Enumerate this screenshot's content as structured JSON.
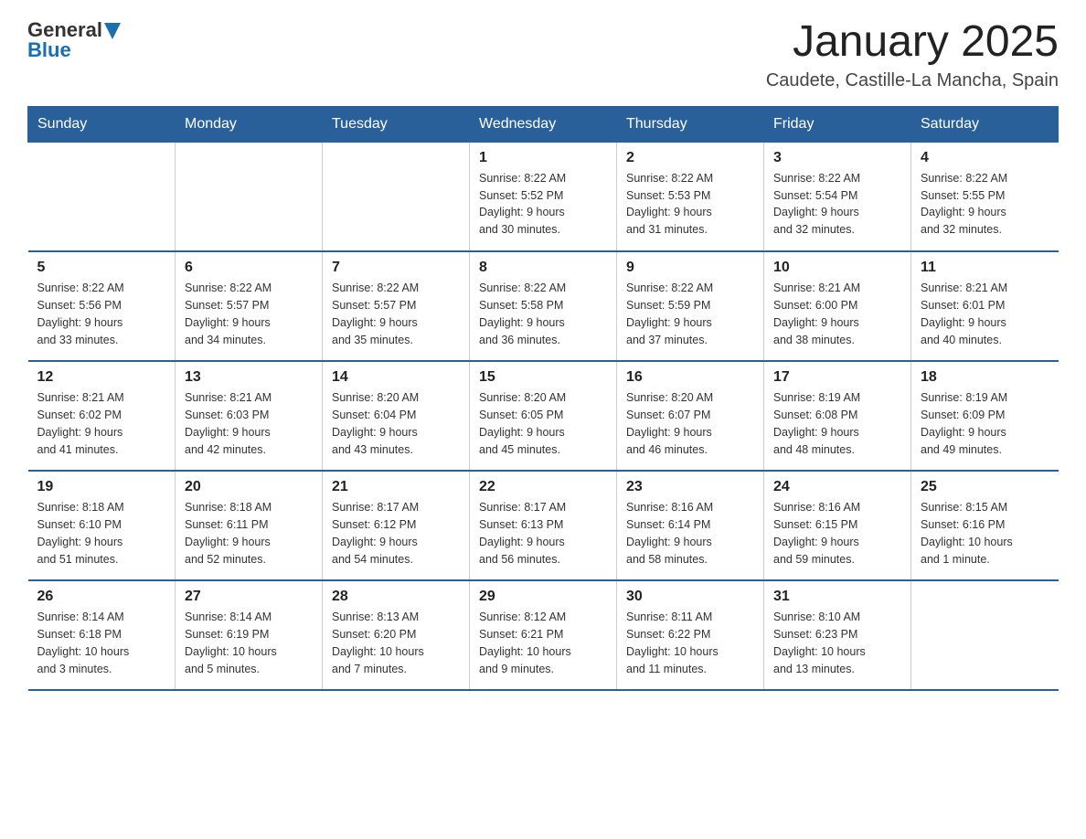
{
  "header": {
    "logo": {
      "general": "General",
      "blue": "Blue"
    },
    "title": "January 2025",
    "location": "Caudete, Castille-La Mancha, Spain"
  },
  "weekdays": [
    "Sunday",
    "Monday",
    "Tuesday",
    "Wednesday",
    "Thursday",
    "Friday",
    "Saturday"
  ],
  "weeks": [
    [
      {
        "day": "",
        "info": ""
      },
      {
        "day": "",
        "info": ""
      },
      {
        "day": "",
        "info": ""
      },
      {
        "day": "1",
        "info": "Sunrise: 8:22 AM\nSunset: 5:52 PM\nDaylight: 9 hours\nand 30 minutes."
      },
      {
        "day": "2",
        "info": "Sunrise: 8:22 AM\nSunset: 5:53 PM\nDaylight: 9 hours\nand 31 minutes."
      },
      {
        "day": "3",
        "info": "Sunrise: 8:22 AM\nSunset: 5:54 PM\nDaylight: 9 hours\nand 32 minutes."
      },
      {
        "day": "4",
        "info": "Sunrise: 8:22 AM\nSunset: 5:55 PM\nDaylight: 9 hours\nand 32 minutes."
      }
    ],
    [
      {
        "day": "5",
        "info": "Sunrise: 8:22 AM\nSunset: 5:56 PM\nDaylight: 9 hours\nand 33 minutes."
      },
      {
        "day": "6",
        "info": "Sunrise: 8:22 AM\nSunset: 5:57 PM\nDaylight: 9 hours\nand 34 minutes."
      },
      {
        "day": "7",
        "info": "Sunrise: 8:22 AM\nSunset: 5:57 PM\nDaylight: 9 hours\nand 35 minutes."
      },
      {
        "day": "8",
        "info": "Sunrise: 8:22 AM\nSunset: 5:58 PM\nDaylight: 9 hours\nand 36 minutes."
      },
      {
        "day": "9",
        "info": "Sunrise: 8:22 AM\nSunset: 5:59 PM\nDaylight: 9 hours\nand 37 minutes."
      },
      {
        "day": "10",
        "info": "Sunrise: 8:21 AM\nSunset: 6:00 PM\nDaylight: 9 hours\nand 38 minutes."
      },
      {
        "day": "11",
        "info": "Sunrise: 8:21 AM\nSunset: 6:01 PM\nDaylight: 9 hours\nand 40 minutes."
      }
    ],
    [
      {
        "day": "12",
        "info": "Sunrise: 8:21 AM\nSunset: 6:02 PM\nDaylight: 9 hours\nand 41 minutes."
      },
      {
        "day": "13",
        "info": "Sunrise: 8:21 AM\nSunset: 6:03 PM\nDaylight: 9 hours\nand 42 minutes."
      },
      {
        "day": "14",
        "info": "Sunrise: 8:20 AM\nSunset: 6:04 PM\nDaylight: 9 hours\nand 43 minutes."
      },
      {
        "day": "15",
        "info": "Sunrise: 8:20 AM\nSunset: 6:05 PM\nDaylight: 9 hours\nand 45 minutes."
      },
      {
        "day": "16",
        "info": "Sunrise: 8:20 AM\nSunset: 6:07 PM\nDaylight: 9 hours\nand 46 minutes."
      },
      {
        "day": "17",
        "info": "Sunrise: 8:19 AM\nSunset: 6:08 PM\nDaylight: 9 hours\nand 48 minutes."
      },
      {
        "day": "18",
        "info": "Sunrise: 8:19 AM\nSunset: 6:09 PM\nDaylight: 9 hours\nand 49 minutes."
      }
    ],
    [
      {
        "day": "19",
        "info": "Sunrise: 8:18 AM\nSunset: 6:10 PM\nDaylight: 9 hours\nand 51 minutes."
      },
      {
        "day": "20",
        "info": "Sunrise: 8:18 AM\nSunset: 6:11 PM\nDaylight: 9 hours\nand 52 minutes."
      },
      {
        "day": "21",
        "info": "Sunrise: 8:17 AM\nSunset: 6:12 PM\nDaylight: 9 hours\nand 54 minutes."
      },
      {
        "day": "22",
        "info": "Sunrise: 8:17 AM\nSunset: 6:13 PM\nDaylight: 9 hours\nand 56 minutes."
      },
      {
        "day": "23",
        "info": "Sunrise: 8:16 AM\nSunset: 6:14 PM\nDaylight: 9 hours\nand 58 minutes."
      },
      {
        "day": "24",
        "info": "Sunrise: 8:16 AM\nSunset: 6:15 PM\nDaylight: 9 hours\nand 59 minutes."
      },
      {
        "day": "25",
        "info": "Sunrise: 8:15 AM\nSunset: 6:16 PM\nDaylight: 10 hours\nand 1 minute."
      }
    ],
    [
      {
        "day": "26",
        "info": "Sunrise: 8:14 AM\nSunset: 6:18 PM\nDaylight: 10 hours\nand 3 minutes."
      },
      {
        "day": "27",
        "info": "Sunrise: 8:14 AM\nSunset: 6:19 PM\nDaylight: 10 hours\nand 5 minutes."
      },
      {
        "day": "28",
        "info": "Sunrise: 8:13 AM\nSunset: 6:20 PM\nDaylight: 10 hours\nand 7 minutes."
      },
      {
        "day": "29",
        "info": "Sunrise: 8:12 AM\nSunset: 6:21 PM\nDaylight: 10 hours\nand 9 minutes."
      },
      {
        "day": "30",
        "info": "Sunrise: 8:11 AM\nSunset: 6:22 PM\nDaylight: 10 hours\nand 11 minutes."
      },
      {
        "day": "31",
        "info": "Sunrise: 8:10 AM\nSunset: 6:23 PM\nDaylight: 10 hours\nand 13 minutes."
      },
      {
        "day": "",
        "info": ""
      }
    ]
  ]
}
